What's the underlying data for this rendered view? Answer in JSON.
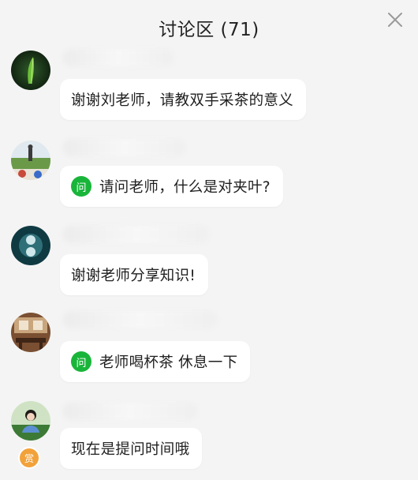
{
  "header": {
    "title": "讨论区 (71)",
    "close_icon": "close-icon"
  },
  "colors": {
    "background": "#f4f4f4",
    "bubble": "#ffffff",
    "question_badge": "#19b53a",
    "reward_badge": "#f2a23a"
  },
  "messages": [
    {
      "text": "谢谢刘老师，请教双手采茶的意义",
      "is_question": false,
      "avatar": "tea-leaf-avatar"
    },
    {
      "text": "请问老师，什么是对夹叶?",
      "is_question": true,
      "badge_label": "问",
      "avatar": "field-avatar"
    },
    {
      "text": "谢谢老师分享知识!",
      "is_question": false,
      "avatar": "circle-avatar"
    },
    {
      "text": "老师喝杯茶 休息一下",
      "is_question": true,
      "badge_label": "问",
      "avatar": "teahouse-avatar"
    },
    {
      "text": "现在是提问时间哦",
      "is_question": false,
      "avatar": "girl-avatar",
      "reward_label": "赏"
    }
  ]
}
